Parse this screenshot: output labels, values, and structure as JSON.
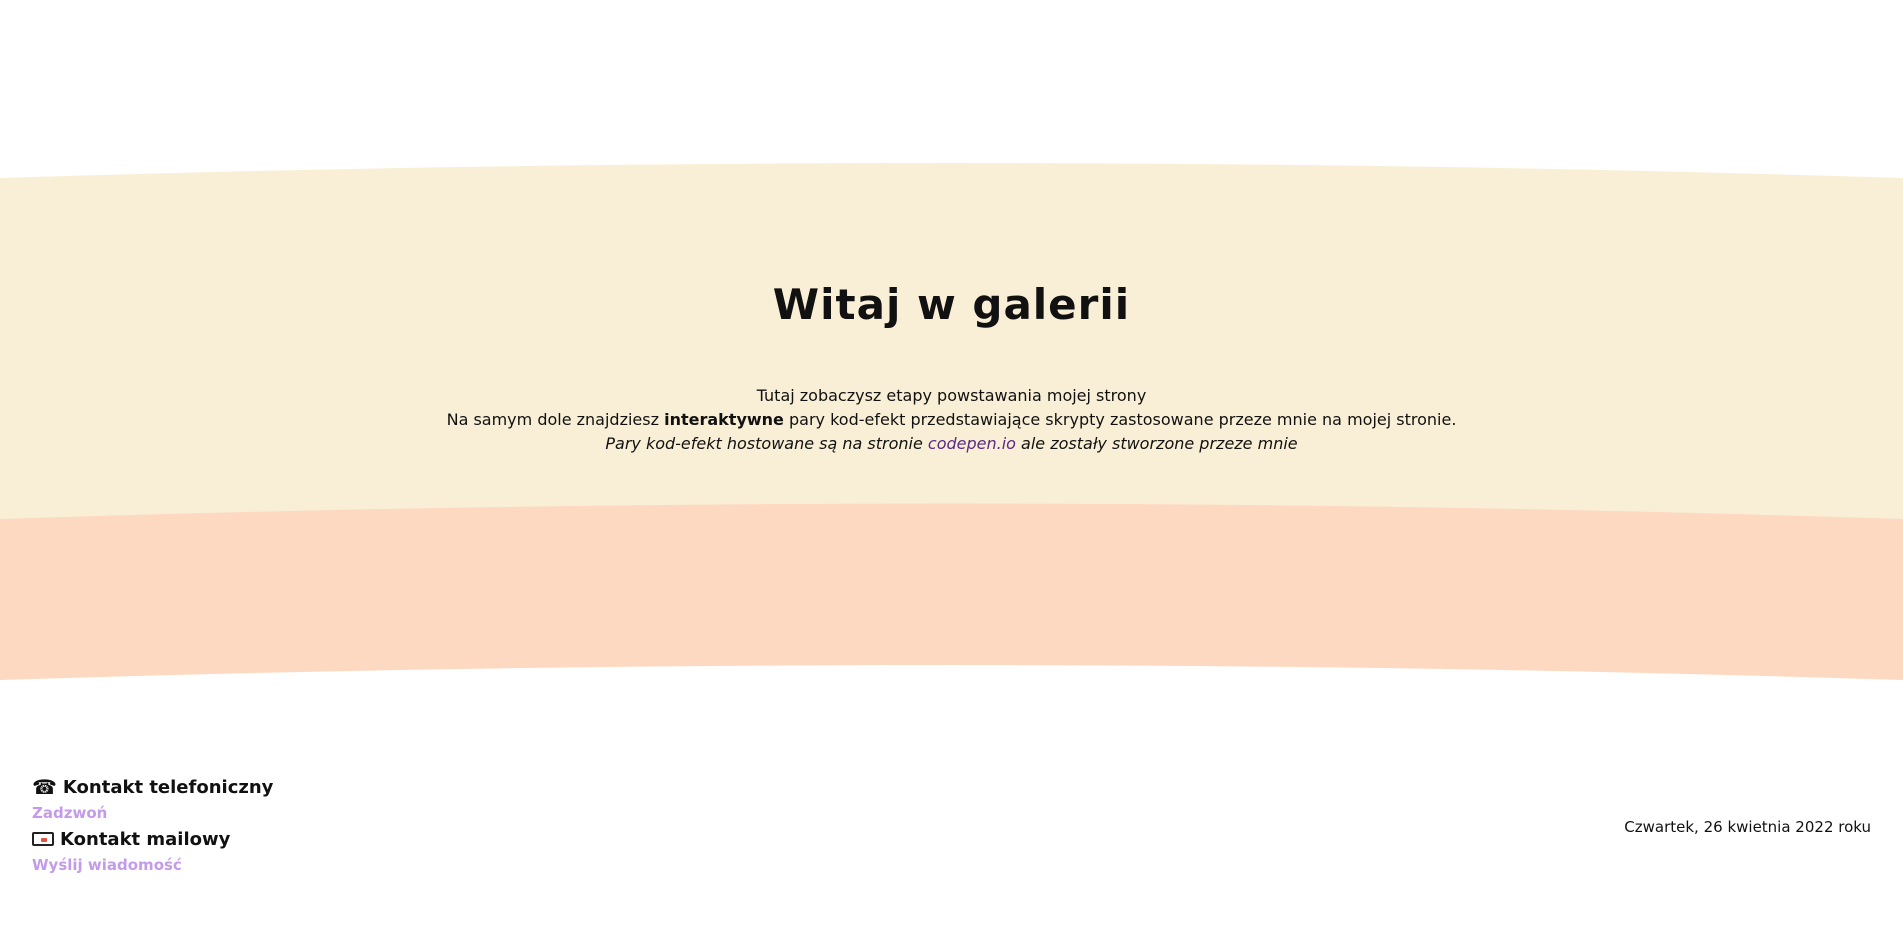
{
  "hero": {
    "title": "Witaj w galerii",
    "line1": "Tutaj zobaczysz etapy powstawania mojej strony",
    "line2_before": "Na samym dole znajdziesz ",
    "line2_bold": "interaktywne",
    "line2_after": " pary kod-efekt przedstawiające skrypty zastosowane przeze mnie na mojej stronie.",
    "line3_before": "Pary kod-efekt hostowane są na stronie ",
    "line3_link": "codepen.io",
    "line3_after": " ale zostały stworzone przeze mnie"
  },
  "colors": {
    "band_cream": "#f9efd6",
    "band_peach": "#fdd9c2",
    "link_purple": "#5b2a86",
    "contact_link": "#c49be8"
  },
  "footer": {
    "phone": {
      "icon": "telephone-icon",
      "heading": "Kontakt telefoniczny",
      "link": "Zadzwoń"
    },
    "mail": {
      "icon": "envelope-icon",
      "heading": "Kontakt mailowy",
      "link": "Wyślij wiadomość"
    },
    "date": "Czwartek, 26 kwietnia 2022 roku"
  }
}
